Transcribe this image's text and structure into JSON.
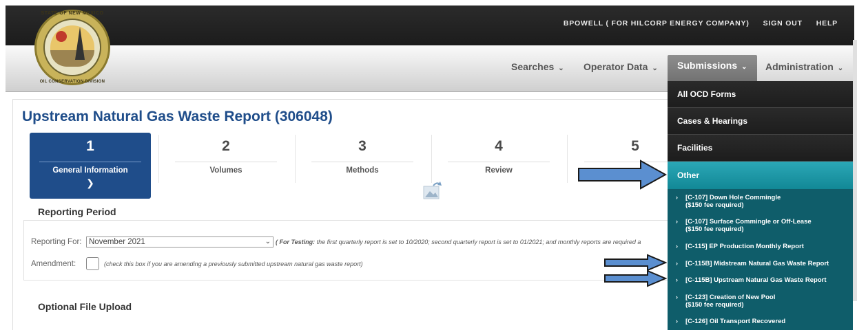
{
  "header": {
    "user": "BPOWELL ( FOR HILCORP ENERGY COMPANY)",
    "sign_out": "SIGN OUT",
    "help": "HELP"
  },
  "logo": {
    "top_text": "STATE OF NEW MEXICO",
    "bottom_text": "OIL CONSERVATION DIVISION"
  },
  "nav": {
    "searches": "Searches",
    "operator_data": "Operator Data",
    "submissions": "Submissions",
    "administration": "Administration"
  },
  "dropdown": {
    "main_items": [
      "All OCD Forms",
      "Cases & Hearings",
      "Facilities"
    ],
    "other_label": "Other",
    "sub_items": [
      {
        "line1": "[C-107] Down Hole Commingle",
        "line2": "($150 fee required)"
      },
      {
        "line1": "[C-107] Surface Commingle or Off-Lease",
        "line2": "($150 fee required)"
      },
      {
        "line1": "[C-115] EP Production Monthly Report",
        "line2": ""
      },
      {
        "line1": "[C-115B] Midstream Natural Gas Waste Report",
        "line2": ""
      },
      {
        "line1": "[C-115B] Upstream Natural Gas Waste Report",
        "line2": ""
      },
      {
        "line1": "[C-123] Creation of New Pool",
        "line2": "($150 fee required)"
      },
      {
        "line1": "[C-126] Oil Transport Recovered",
        "line2": ""
      }
    ]
  },
  "page": {
    "title": "Upstream Natural Gas Waste Report (306048)"
  },
  "steps": [
    {
      "num": "1",
      "label": "General Information"
    },
    {
      "num": "2",
      "label": "Volumes"
    },
    {
      "num": "3",
      "label": "Methods"
    },
    {
      "num": "4",
      "label": "Review"
    },
    {
      "num": "5",
      "label": ""
    }
  ],
  "reporting_period": {
    "title": "Reporting Period",
    "reporting_for_label": "Reporting For:",
    "reporting_for_value": "November 2021",
    "testing_note_bold": "( For Testing:",
    "testing_note": " the first quarterly report is set to 10/2020; second quarterly report is set to 01/2021; and monthly reports are required a",
    "amendment_label": "Amendment:",
    "amendment_note": "(check this box if you are amending a previously submitted upstream natural gas waste report)"
  },
  "optional_upload": {
    "title": "Optional File Upload"
  },
  "colors": {
    "title_blue": "#1f4d8a",
    "menu_teal": "#0f5d6a",
    "other_highlight": "#2ba7b6",
    "arrow_fill": "#5b8fd0"
  }
}
